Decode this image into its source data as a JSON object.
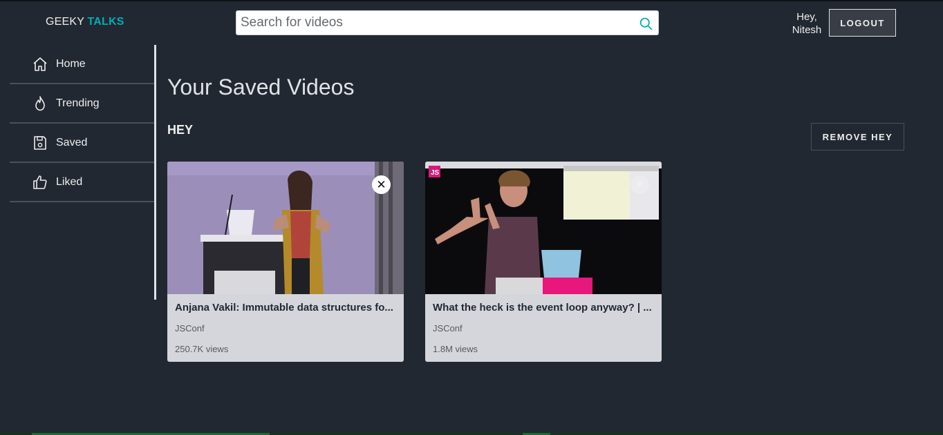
{
  "header": {
    "logo_part1": "GEEKY",
    "logo_part2": "TALKS",
    "search_placeholder": "Search for videos",
    "greeting": "Hey,",
    "username": "Nitesh",
    "logout_label": "LOGOUT"
  },
  "sidebar": {
    "items": [
      {
        "label": "Home",
        "icon": "home-icon"
      },
      {
        "label": "Trending",
        "icon": "flame-icon"
      },
      {
        "label": "Saved",
        "icon": "save-icon"
      },
      {
        "label": "Liked",
        "icon": "thumbs-up-icon"
      }
    ]
  },
  "main": {
    "page_title": "Your Saved Videos",
    "list_name": "HEY",
    "remove_label": "REMOVE HEY",
    "videos": [
      {
        "title": "Anjana Vakil: Immutable data structures fo...",
        "channel": "JSConf",
        "views": "250.7K views"
      },
      {
        "title": "What the heck is the event loop anyway? | ...",
        "channel": "JSConf",
        "views": "1.8M views"
      }
    ],
    "close_glyph": "✕",
    "thumb_badge": "JS"
  },
  "colors": {
    "background": "#222831",
    "accent": "#00adb5",
    "card": "#d4d6dc",
    "button": "#393e46"
  }
}
